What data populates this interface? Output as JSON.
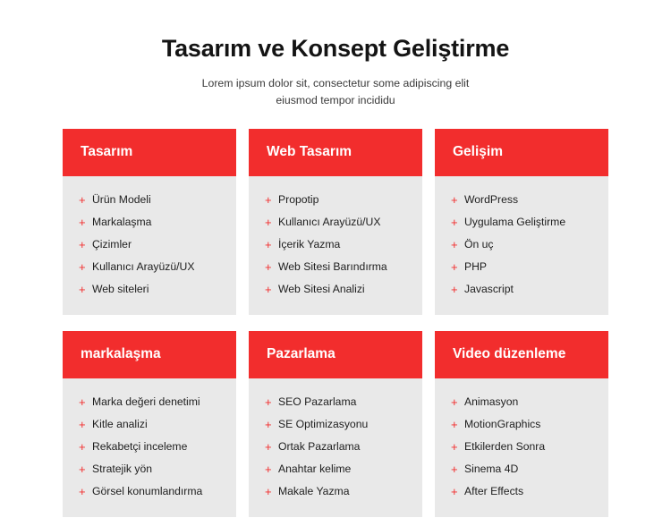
{
  "header": {
    "title": "Tasarım ve Konsept Geliştirme",
    "subtitle_line1": "Lorem ipsum dolor sit, consectetur some adipiscing elit",
    "subtitle_line2": "eiusmod tempor incididu"
  },
  "theme": {
    "accent": "#f22d2d",
    "card_bg": "#e9e9e9",
    "text": "#1e1e1e"
  },
  "bullet": "+",
  "cards": [
    {
      "title": "Tasarım",
      "items": [
        "Ürün Modeli",
        "Markalaşma",
        "Çizimler",
        "Kullanıcı Arayüzü/UX",
        "Web siteleri"
      ]
    },
    {
      "title": "Web Tasarım",
      "items": [
        "Propotip",
        "Kullanıcı Arayüzü/UX",
        "İçerik Yazma",
        "Web Sitesi Barındırma",
        "Web Sitesi Analizi"
      ]
    },
    {
      "title": "Gelişim",
      "items": [
        "WordPress",
        "Uygulama Geliştirme",
        "Ön uç",
        "PHP",
        "Javascript"
      ]
    },
    {
      "title": "markalaşma",
      "items": [
        "Marka değeri denetimi",
        "Kitle analizi",
        "Rekabetçi inceleme",
        "Stratejik yön",
        "Görsel konumlandırma"
      ]
    },
    {
      "title": "Pazarlama",
      "items": [
        "SEO Pazarlama",
        "SE Optimizasyonu",
        "Ortak Pazarlama",
        "Anahtar kelime",
        "Makale Yazma"
      ]
    },
    {
      "title": "Video düzenleme",
      "items": [
        "Animasyon",
        "MotionGraphics",
        "Etkilerden Sonra",
        "Sinema 4D",
        "After Effects"
      ]
    }
  ]
}
